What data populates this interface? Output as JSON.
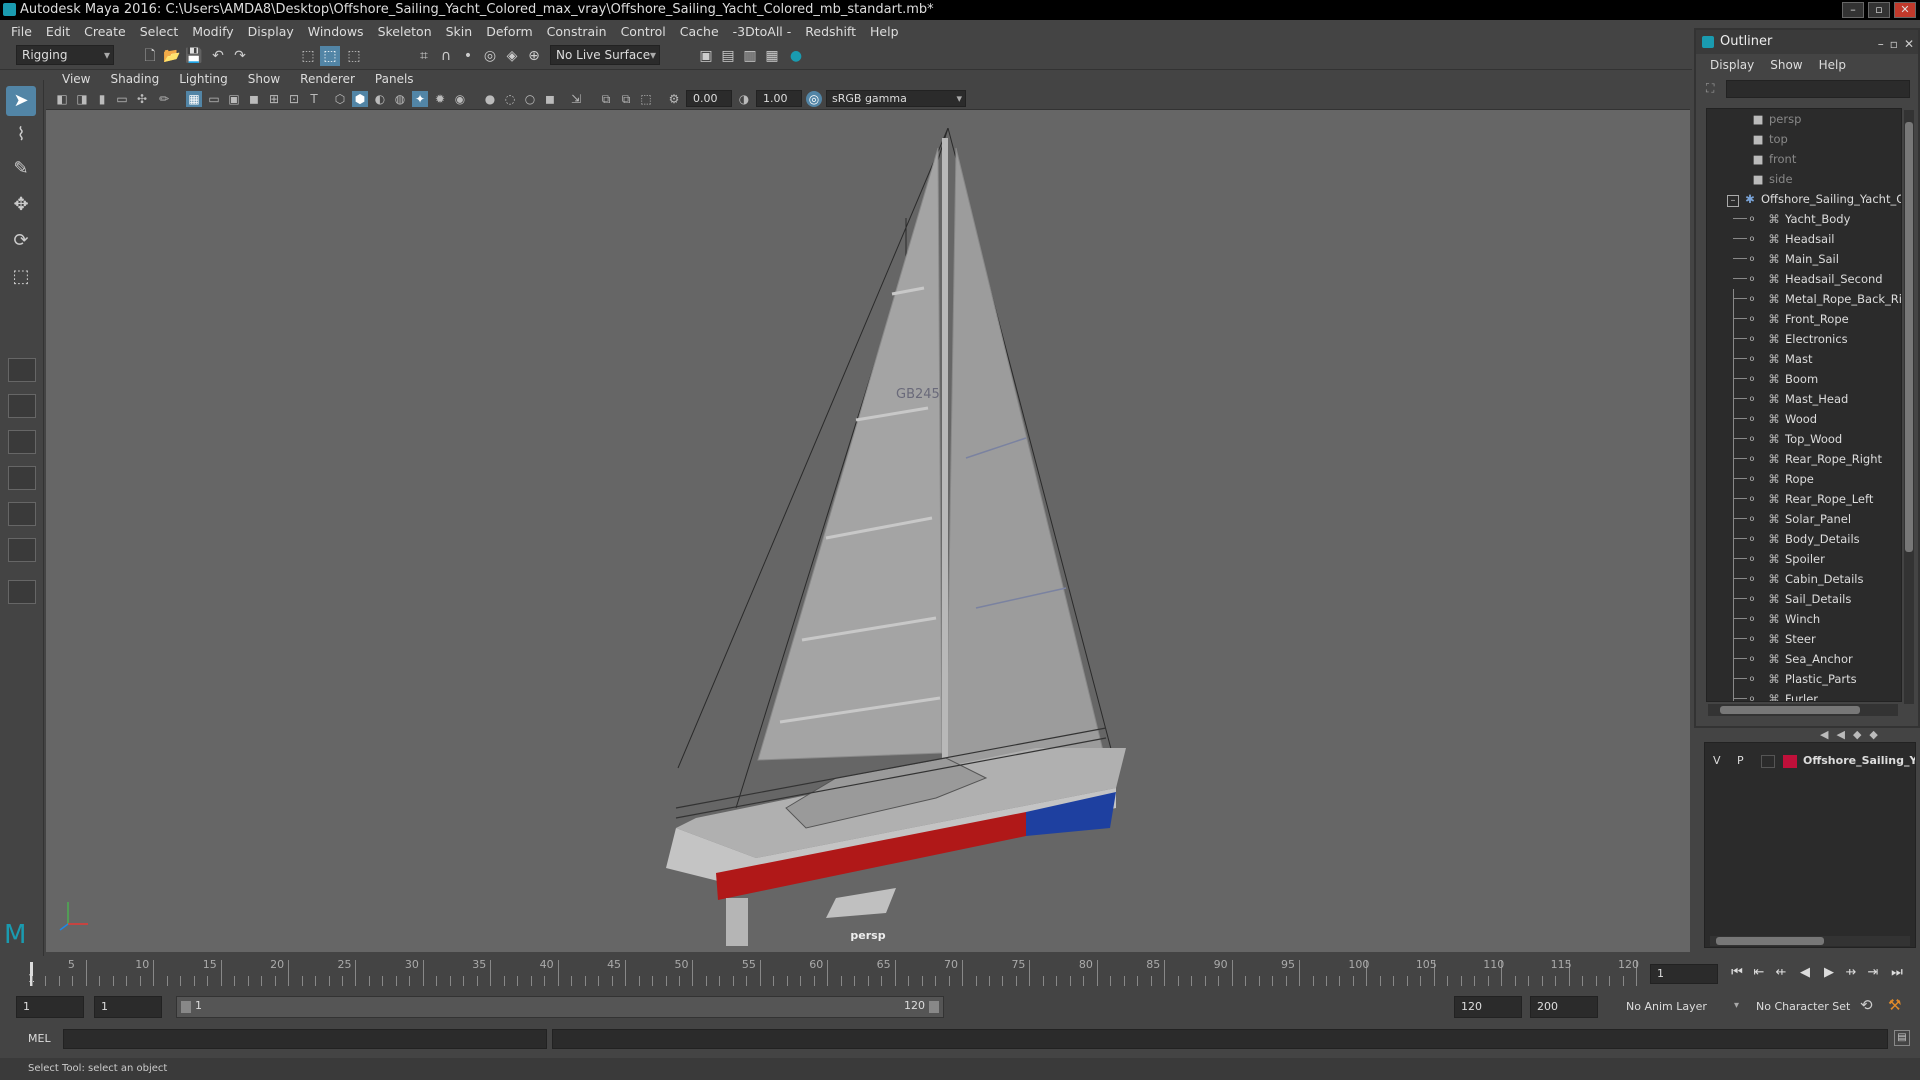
{
  "window": {
    "title": "Autodesk Maya 2016: C:\\Users\\AMDA8\\Desktop\\Offshore_Sailing_Yacht_Colored_max_vray\\Offshore_Sailing_Yacht_Colored_mb_standart.mb*"
  },
  "menus": [
    "File",
    "Edit",
    "Create",
    "Select",
    "Modify",
    "Display",
    "Windows",
    "Skeleton",
    "Skin",
    "Deform",
    "Constrain",
    "Control",
    "Cache",
    "-3DtoAll -",
    "Redshift",
    "Help"
  ],
  "shelf": {
    "mode": "Rigging",
    "live_surface": "No Live Surface"
  },
  "panel": {
    "menus": [
      "View",
      "Shading",
      "Lighting",
      "Show",
      "Renderer",
      "Panels"
    ],
    "exposure": "0.00",
    "gamma": "1.00",
    "color_space": "sRGB gamma"
  },
  "viewport": {
    "camera_label": "persp",
    "hull_text": "GB245"
  },
  "timeline": {
    "ticks": [
      "5",
      "10",
      "15",
      "20",
      "25",
      "30",
      "35",
      "40",
      "45",
      "50",
      "55",
      "60",
      "65",
      "70",
      "75",
      "80",
      "85",
      "90",
      "95",
      "100",
      "105",
      "110",
      "115",
      "120"
    ],
    "start_marker": "1",
    "current_frame": "1"
  },
  "range": {
    "start": "1",
    "playback_start": "1",
    "slider_start": "1",
    "slider_end": "120",
    "playback_end": "120",
    "end": "200",
    "anim_layer": "No Anim Layer",
    "character_set": "No Character Set"
  },
  "command": {
    "label": "MEL"
  },
  "help": {
    "text": "Select Tool: select an object"
  },
  "outliner": {
    "title": "Outliner",
    "menus": [
      "Display",
      "Show",
      "Help"
    ],
    "cameras": [
      "persp",
      "top",
      "front",
      "side"
    ],
    "root": "Offshore_Sailing_Yacht_Co",
    "children": [
      "Yacht_Body",
      "Headsail",
      "Main_Sail",
      "Headsail_Second",
      "Metal_Rope_Back_Righ",
      "Front_Rope",
      "Electronics",
      "Mast",
      "Boom",
      "Mast_Head",
      "Wood",
      "Top_Wood",
      "Rear_Rope_Right",
      "Rope",
      "Rear_Rope_Left",
      "Solar_Panel",
      "Body_Details",
      "Spoiler",
      "Cabin_Details",
      "Sail_Details",
      "Winch",
      "Steer",
      "Sea_Anchor",
      "Plastic_Parts",
      "Furler"
    ]
  },
  "layers": {
    "v": "V",
    "p": "P",
    "name": "Offshore_Sailing_Yacht",
    "color": "#c0103a"
  },
  "colors": {
    "accent": "#5285a6",
    "hull_red": "#b01818",
    "hull_blue": "#1e40a0",
    "viewport_bg": "#666666"
  }
}
